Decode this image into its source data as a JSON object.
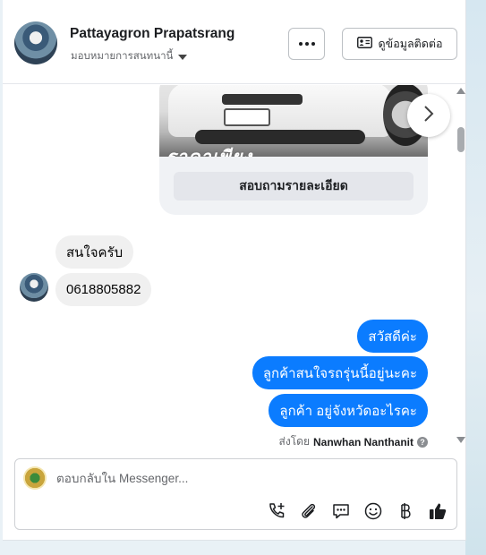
{
  "header": {
    "contact_name": "Pattayagron Prapatsrang",
    "assign_label": "มอบหมายการสนทนานี้",
    "contact_info_label": "ดูข้อมูลติดต่อ"
  },
  "card": {
    "image_caption": "ราคาเพียง",
    "button_label": "สอบถามรายละเอียด"
  },
  "messages": {
    "incoming": [
      "สนใจครับ",
      "0618805882"
    ],
    "outgoing": [
      "สวัสดีค่ะ",
      "ลูกค้าสนใจรถรุ่นนี้อยู่นะคะ",
      "ลูกค้า  อยู่จังหวัดอะไรคะ"
    ]
  },
  "sent_by": {
    "prefix": "ส่งโดย",
    "name": "Nanwhan Nanthanit",
    "help_glyph": "?"
  },
  "composer": {
    "placeholder": "ตอบกลับใน Messenger..."
  },
  "colors": {
    "outgoing_bubble": "#0b7cff",
    "incoming_bubble": "#f0f0f0",
    "text_primary": "#1c1e21"
  },
  "icons": {
    "header": [
      "more-options-icon",
      "contact-card-icon",
      "chevron-down-icon"
    ],
    "carousel": "chevron-right-icon",
    "toolbar": [
      "call-plus-icon",
      "paperclip-icon",
      "saved-reply-icon",
      "emoji-icon",
      "baht-payment-icon",
      "thumbs-up-icon"
    ]
  }
}
